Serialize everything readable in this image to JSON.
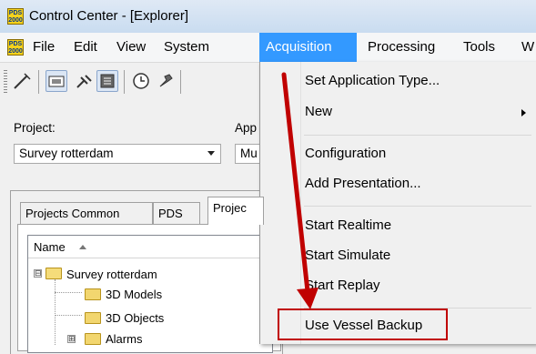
{
  "window": {
    "title": "Control Center - [Explorer]",
    "app_icon_text": "PDS 2000"
  },
  "menubar": {
    "items": [
      "File",
      "Edit",
      "View",
      "System",
      "Acquisition",
      "Processing",
      "Tools",
      "W"
    ]
  },
  "toolbar": {
    "icons": [
      "wand-icon",
      "display-icon",
      "satellite-icon",
      "list-icon",
      "clock-icon",
      "tool-icon"
    ]
  },
  "project": {
    "label": "Project:",
    "value": "Survey rotterdam"
  },
  "application": {
    "label": "App",
    "value": "Mu"
  },
  "tabs": [
    "Projects Common",
    "PDS",
    "Projec"
  ],
  "tree": {
    "column_header": "Name",
    "items": [
      {
        "label": "Survey rotterdam",
        "expander": "⊟"
      },
      {
        "label": "3D Models"
      },
      {
        "label": "3D Objects"
      },
      {
        "label": "Alarms",
        "expander": "⊞"
      }
    ]
  },
  "acquisition_menu": {
    "items": [
      "Set Application Type...",
      "New",
      "Configuration",
      "Add Presentation...",
      "Start Realtime",
      "Start Simulate",
      "Start Replay",
      "Use Vessel Backup"
    ]
  },
  "colors": {
    "menu_highlight": "#3399ff",
    "callout": "#c00000"
  }
}
